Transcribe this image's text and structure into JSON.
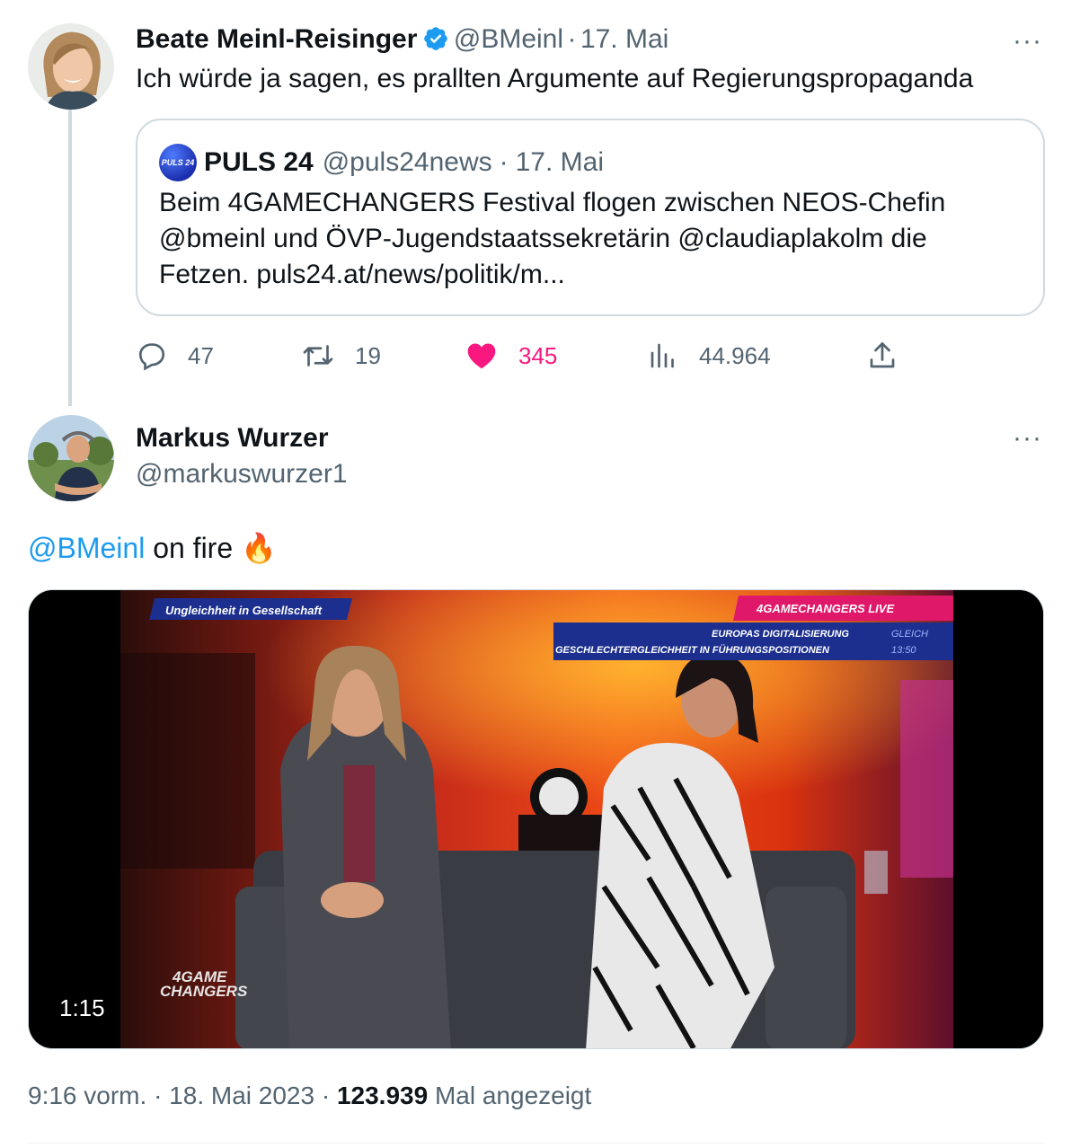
{
  "tweet1": {
    "author_name": "Beate Meinl-Reisinger",
    "handle": "@BMeinl",
    "separator": "·",
    "date": "17. Mai",
    "text": "Ich würde ja sagen, es prallten Argumente auf Regierungspropaganda",
    "more_label": "···",
    "quote": {
      "logo_text": "PULS 24",
      "author_name": "PULS 24",
      "handle": "@puls24news",
      "separator": "·",
      "date": "17. Mai",
      "text": "Beim 4GAMECHANGERS Festival flogen zwischen NEOS-Chefin @bmeinl und ÖVP-Jugendstaatssekretärin @claudiaplakolm die Fetzen.  puls24.at/news/politik/m..."
    },
    "actions": {
      "replies": "47",
      "retweets": "19",
      "likes": "345",
      "views": "44.964"
    }
  },
  "tweet2": {
    "author_name": "Markus Wurzer",
    "handle": "@markuswurzer1",
    "more_label": "···",
    "mention": "@BMeinl",
    "text": "on fire",
    "emoji": "🔥",
    "video": {
      "duration": "1:15",
      "overlay_left_tag": "Ungleichheit in Gesellschaft",
      "overlay_live": "4GAMECHANGERS LIVE",
      "overlay_line1": "EUROPAS DIGITALISIERUNG",
      "overlay_line1_right": "GLEICH",
      "overlay_line2": "GESCHLECHTERGLEICHHEIT IN FÜHRUNGSPOSITIONEN",
      "overlay_line2_right": "13:50",
      "logo_line1": "4GAME",
      "logo_line2": "CHANGERS"
    },
    "footer": {
      "time": "9:16 vorm.",
      "separator": "·",
      "date": "18. Mai 2023",
      "separator2": "·",
      "views": "123.939",
      "views_label": "Mal angezeigt"
    }
  },
  "colors": {
    "accent": "#1d9bf0",
    "like": "#f91880",
    "muted": "#536471",
    "border": "#cfd9de"
  }
}
